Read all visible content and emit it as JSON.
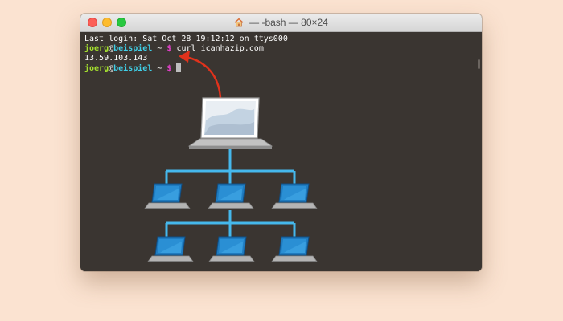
{
  "window": {
    "title": "— -bash — 80×24"
  },
  "terminal": {
    "last_login": "Last login: Sat Oct 28 19:12:12 on ttys000",
    "prompt_user": "joerg",
    "prompt_at": "@",
    "prompt_host": "beispiel",
    "prompt_path": "~",
    "prompt_symbol": "$",
    "command": "curl icanhazip.com",
    "output": "13.59.103.143"
  },
  "colors": {
    "background": "#fbe3d1",
    "terminal_bg": "#3a3531",
    "user": "#a6e22e",
    "host": "#40d0e8",
    "dollar": "#e040c8",
    "arrow": "#e0321c",
    "network_line": "#45b8ec",
    "device_screen": "#1f7bbf"
  },
  "icons": {
    "title_icon": "home-icon"
  }
}
